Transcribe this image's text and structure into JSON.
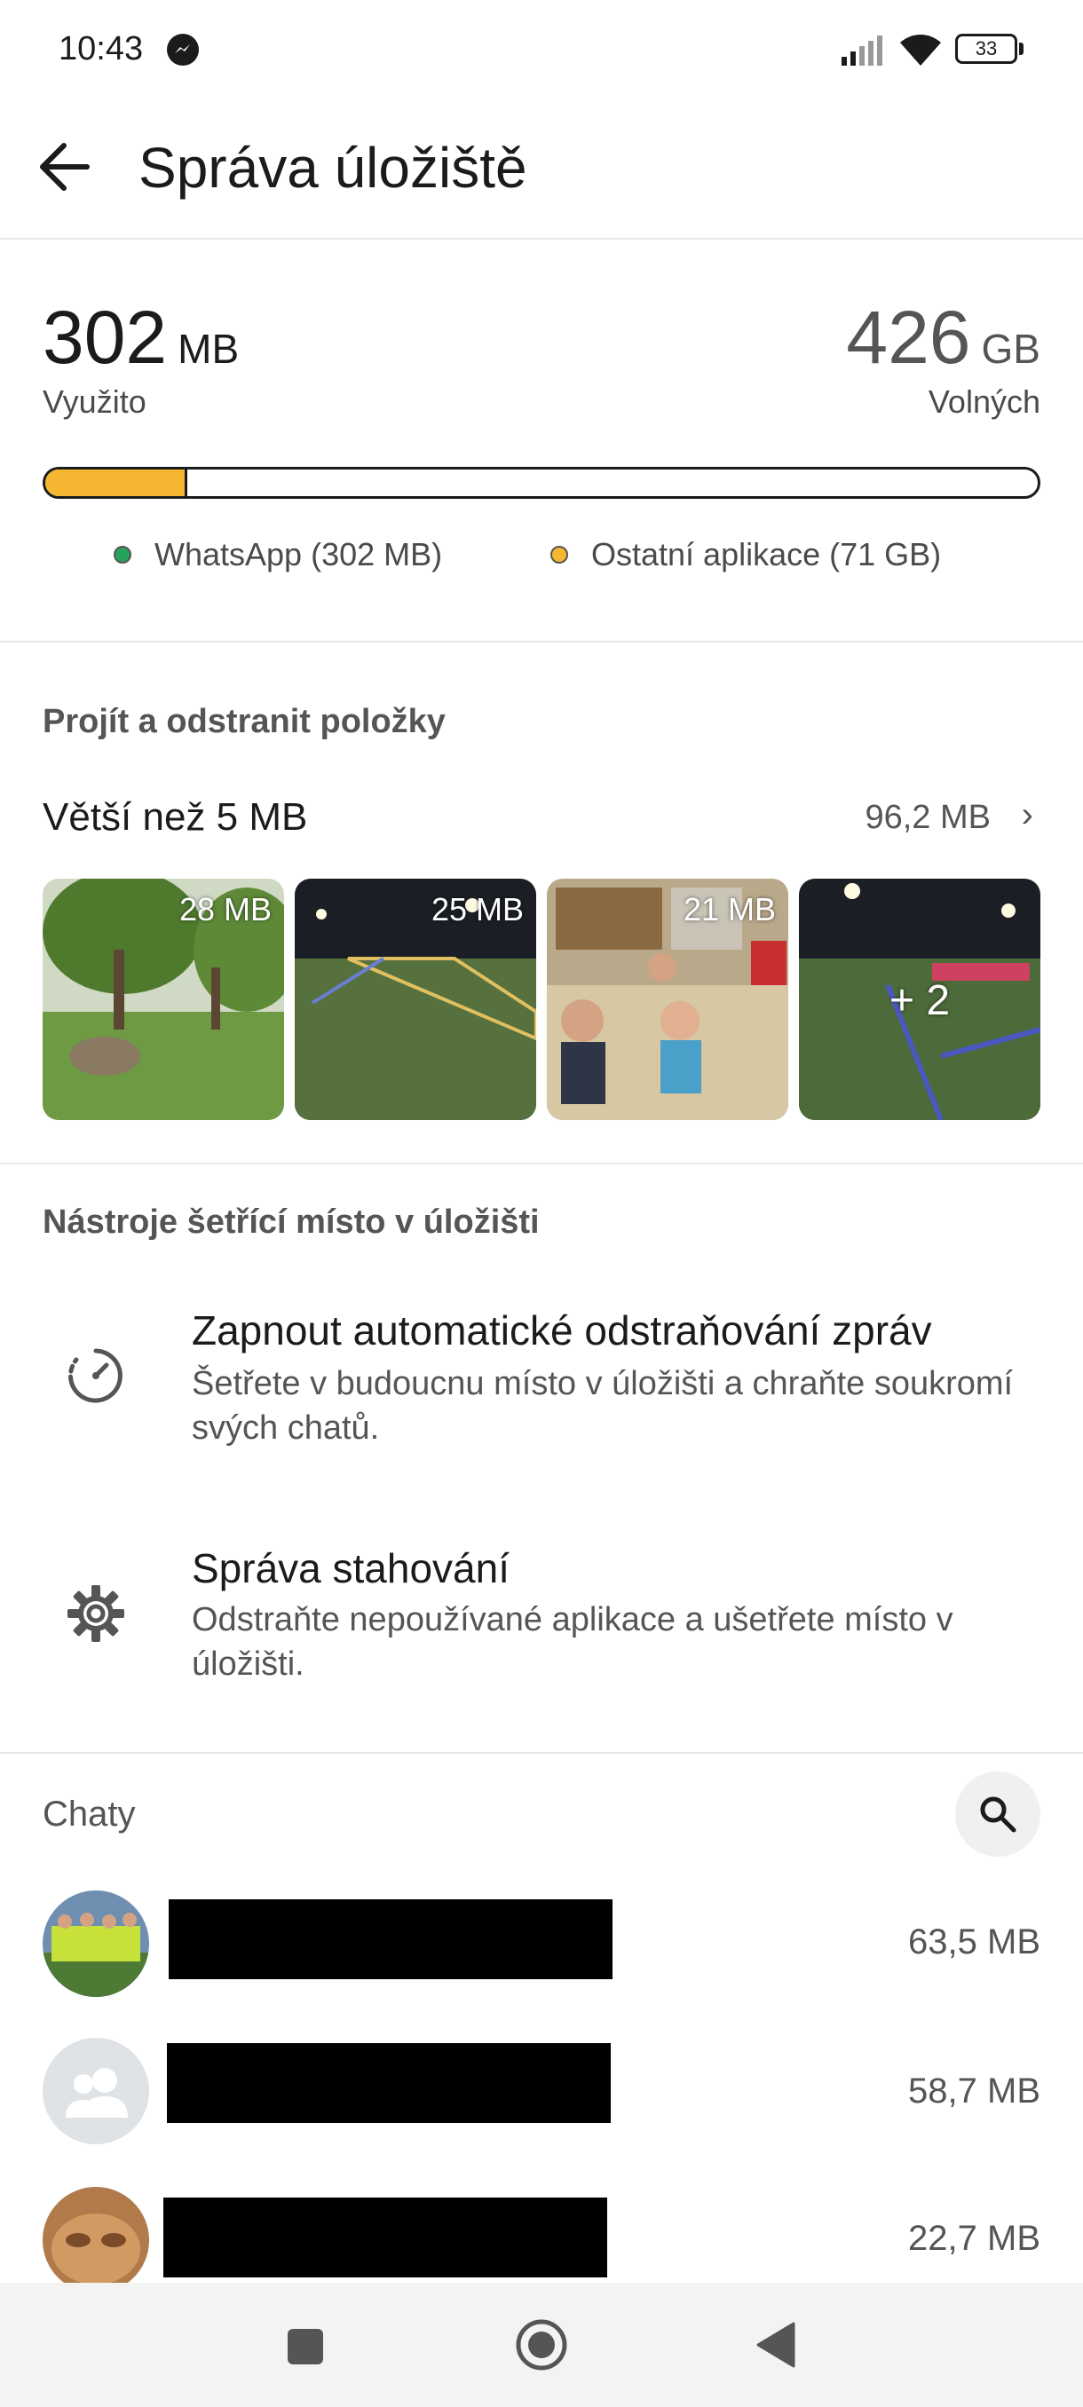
{
  "status_bar": {
    "time": "10:43",
    "battery": "33"
  },
  "header": {
    "title": "Správa úložiště"
  },
  "storage": {
    "used_value": "302",
    "used_unit": "MB",
    "used_label": "Využito",
    "free_value": "426",
    "free_unit": "GB",
    "free_label": "Volných",
    "used_fraction": 0.14,
    "legend": [
      {
        "label": "WhatsApp (302 MB)",
        "color": "#25a35a"
      },
      {
        "label": "Ostatní aplikace (71 GB)",
        "color": "#f5b731"
      }
    ]
  },
  "review": {
    "heading": "Projít a odstranit položky",
    "larger_label": "Větší než 5 MB",
    "larger_size": "96,2 MB",
    "thumbnails": [
      {
        "label": "28 MB",
        "icon": "park-photo"
      },
      {
        "label": "25 MB",
        "icon": "football-pitch-photo"
      },
      {
        "label": "21 MB",
        "icon": "classroom-photo"
      },
      {
        "label": "+ 2",
        "icon": "sports-field-photo"
      }
    ]
  },
  "tools": {
    "heading": "Nástroje šetřící místo v úložišti",
    "items": [
      {
        "title": "Zapnout automatické odstraňování zpráv",
        "subtitle": "Šetřete v budoucnu místo v úložišti a chraňte soukromí svých chatů.",
        "icon": "timer-icon"
      },
      {
        "title": "Správa stahování",
        "subtitle": "Odstraňte nepoužívané aplikace a ušetřete místo v úložišti.",
        "icon": "gear-icon"
      }
    ]
  },
  "chats": {
    "heading": "Chaty",
    "items": [
      {
        "size": "63,5 MB",
        "avatar": "team-photo"
      },
      {
        "size": "58,7 MB",
        "avatar": "group-icon"
      },
      {
        "size": "22,7 MB",
        "avatar": "cat-photo"
      }
    ]
  }
}
